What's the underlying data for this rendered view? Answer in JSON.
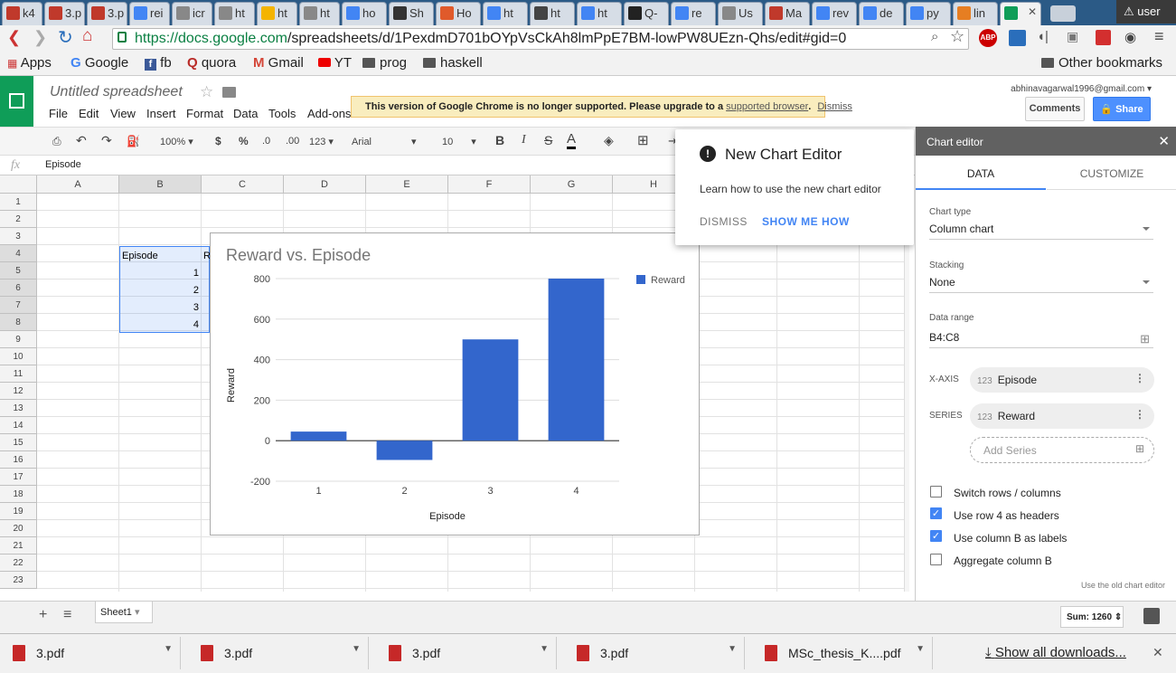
{
  "browser": {
    "tabs": [
      {
        "label": "k4",
        "icon": "S",
        "color": "#c0392b"
      },
      {
        "label": "3.p",
        "icon": "pdf",
        "color": "#c0392b"
      },
      {
        "label": "3.p",
        "icon": "pdf",
        "color": "#c0392b"
      },
      {
        "label": "rei",
        "icon": "G",
        "color": "#4285f4"
      },
      {
        "label": "icr",
        "icon": "doc",
        "color": "#888888"
      },
      {
        "label": "ht",
        "icon": "doc",
        "color": "#888888"
      },
      {
        "label": "ht",
        "icon": "smiley",
        "color": "#f4b400"
      },
      {
        "label": "ht",
        "icon": "doc",
        "color": "#888888"
      },
      {
        "label": "ho",
        "icon": "G",
        "color": "#4285f4"
      },
      {
        "label": "Sh",
        "icon": "w",
        "color": "#333333"
      },
      {
        "label": "Ho",
        "icon": "bookmark",
        "color": "#e05a2b"
      },
      {
        "label": "ht",
        "icon": "G",
        "color": "#4285f4"
      },
      {
        "label": "ht",
        "icon": "DG",
        "color": "#444444"
      },
      {
        "label": "ht",
        "icon": "G",
        "color": "#4285f4"
      },
      {
        "label": "Q-",
        "icon": "W",
        "color": "#222222"
      },
      {
        "label": "re",
        "icon": "G",
        "color": "#4285f4"
      },
      {
        "label": "Us",
        "icon": "doc",
        "color": "#888888"
      },
      {
        "label": "Ma",
        "icon": "S",
        "color": "#c0392b"
      },
      {
        "label": "rev",
        "icon": "G",
        "color": "#4285f4"
      },
      {
        "label": "de",
        "icon": "G",
        "color": "#4285f4"
      },
      {
        "label": "py",
        "icon": "G",
        "color": "#4285f4"
      },
      {
        "label": "lin",
        "icon": "fire",
        "color": "#e67e22"
      },
      {
        "label": "",
        "icon": "sheets",
        "color": "#0f9d58"
      }
    ],
    "user": "user",
    "url_host": "https://docs.google.com",
    "url_path": "/spreadsheets/d/1PexdmD701bOYpVsCkAh8lmPpE7BM-lowPW8UEzn-Qhs/edit#gid=0",
    "bookmarks": [
      {
        "label": "Apps",
        "icon": "apps-icon"
      },
      {
        "label": "Google",
        "icon": "google-icon"
      },
      {
        "label": "fb",
        "icon": "facebook-icon"
      },
      {
        "label": "quora",
        "icon": "quora-icon"
      },
      {
        "label": "Gmail",
        "icon": "gmail-icon"
      },
      {
        "label": "YT",
        "icon": "youtube-icon"
      },
      {
        "label": "prog",
        "icon": "folder-icon"
      },
      {
        "label": "haskell",
        "icon": "folder-icon"
      }
    ],
    "other_bookmarks": "Other bookmarks",
    "extensions": [
      "ABP"
    ]
  },
  "sheets": {
    "title": "Untitled spreadsheet",
    "menus": [
      "File",
      "Edit",
      "View",
      "Insert",
      "Format",
      "Data",
      "Tools",
      "Add-ons"
    ],
    "notice_text": "This version of Google Chrome is no longer supported. Please upgrade to a",
    "notice_link": "supported browser",
    "notice_dismiss": "Dismiss",
    "email": "abhinavagarwal1996@gmail.com",
    "comments": "Comments",
    "share": "Share",
    "toolbar": {
      "zoom": "100%",
      "currency": "$",
      "percent": "%",
      "dec_less": ".0",
      "dec_more": ".00",
      "more_formats": "123",
      "font": "Arial",
      "font_size": "10"
    },
    "formula_fx": "fx",
    "formula_value": "Episode",
    "columns": [
      "A",
      "B",
      "C",
      "D",
      "E",
      "F",
      "G",
      "H"
    ],
    "rows": [
      "1",
      "2",
      "3",
      "4",
      "5",
      "6",
      "7",
      "8",
      "9",
      "10",
      "11",
      "12",
      "13",
      "14",
      "15",
      "16",
      "17",
      "18",
      "19",
      "20",
      "21",
      "22",
      "23"
    ],
    "cells": {
      "b4": "Episode",
      "c4": "R",
      "b5": "1",
      "b6": "2",
      "b7": "3",
      "b8": "4"
    },
    "sheet_tab": "Sheet1",
    "sum": "Sum: 1260"
  },
  "chart_data": {
    "type": "bar",
    "title": "Reward vs. Episode",
    "xlabel": "Episode",
    "ylabel": "Reward",
    "categories": [
      "1",
      "2",
      "3",
      "4"
    ],
    "series": [
      {
        "name": "Reward",
        "values": [
          45,
          -95,
          500,
          800
        ]
      }
    ],
    "ylim": [
      -200,
      800
    ],
    "yticks": [
      "800",
      "600",
      "400",
      "200",
      "0",
      "-200"
    ],
    "color": "#3366cc",
    "legend": "top-right",
    "grid": true
  },
  "popup": {
    "title": "New Chart Editor",
    "body": "Learn how to use the new chart editor",
    "dismiss": "DISMISS",
    "show": "SHOW ME HOW"
  },
  "editor": {
    "title": "Chart editor",
    "tab_data": "DATA",
    "tab_customize": "CUSTOMIZE",
    "chart_type_label": "Chart type",
    "chart_type": "Column chart",
    "stacking_label": "Stacking",
    "stacking": "None",
    "range_label": "Data range",
    "range": "B4:C8",
    "xaxis_label": "X-AXIS",
    "xaxis": "Episode",
    "series_label": "SERIES",
    "series": "Reward",
    "num_badge": "123",
    "add_series": "Add Series",
    "checks": [
      {
        "label": "Switch rows / columns",
        "checked": false
      },
      {
        "label": "Use row 4 as headers",
        "checked": true
      },
      {
        "label": "Use column B as labels",
        "checked": true
      },
      {
        "label": "Aggregate column B",
        "checked": false
      }
    ],
    "old_editor": "Use the old chart editor"
  },
  "downloads": {
    "items": [
      "3.pdf",
      "3.pdf",
      "3.pdf",
      "3.pdf",
      "MSc_thesis_K....pdf"
    ],
    "show_all": "Show all downloads..."
  }
}
